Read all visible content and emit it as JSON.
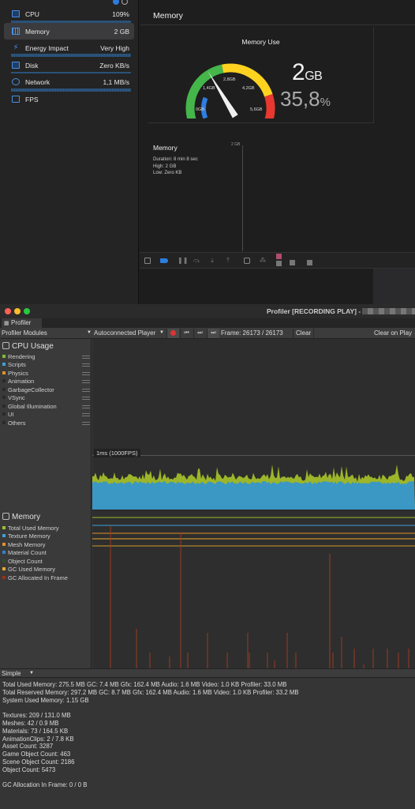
{
  "xcode": {
    "gauges": [
      {
        "name": "CPU",
        "value": "109%",
        "icon": "cpu-icon"
      },
      {
        "name": "Memory",
        "value": "2 GB",
        "icon": "memory-icon",
        "selected": true
      },
      {
        "name": "Energy Impact",
        "value": "Very High",
        "icon": "energy-icon"
      },
      {
        "name": "Disk",
        "value": "Zero KB/s",
        "icon": "disk-icon"
      },
      {
        "name": "Network",
        "value": "1,1 MB/s",
        "icon": "network-icon"
      },
      {
        "name": "FPS",
        "value": "",
        "icon": "fps-icon"
      }
    ],
    "title": "Memory",
    "memory_use": {
      "heading": "Memory Use",
      "value": "2",
      "unit": "GB",
      "percent": "35,8",
      "percent_sign": "%",
      "gauge_fraction": 0.36,
      "ticks": [
        "0GB",
        "1,4GB",
        "2,8GB",
        "4,2GB",
        "5,6GB"
      ],
      "colors": {
        "blue": "#2f7de1",
        "green": "#45b649",
        "yellow": "#ffd21f",
        "red": "#e8382f"
      }
    },
    "memory_graph": {
      "heading": "Memory",
      "duration": "Duration: 8 min 8 sec",
      "high": "High: 2 GB",
      "low": "Low: Zero KB",
      "axis_label": "2 GB"
    }
  },
  "unity": {
    "window_title": "Profiler [RECORDING PLAY] -",
    "window_title_suffix": "20",
    "tab_label": "Profiler",
    "toolbar": {
      "modules": "Profiler Modules",
      "target": "Autoconnected Player",
      "frame": "Frame: 26173 / 26173",
      "clear": "Clear",
      "clear_on_play": "Clear on Play"
    },
    "cpu": {
      "heading": "CPU Usage",
      "legend": [
        {
          "label": "Rendering",
          "color": "#7dbf2e"
        },
        {
          "label": "Scripts",
          "color": "#3ea0d6"
        },
        {
          "label": "Physics",
          "color": "#e0902a"
        },
        {
          "label": "Animation",
          "color": "#2a2a2a"
        },
        {
          "label": "GarbageCollector",
          "color": "#2a2a2a"
        },
        {
          "label": "VSync",
          "color": "#2a2a2a"
        },
        {
          "label": "Global Illumination",
          "color": "#2a2a2a"
        },
        {
          "label": "UI",
          "color": "#2a2a2a"
        },
        {
          "label": "Others",
          "color": "#2a2a2a"
        }
      ],
      "scale_label": "1ms (1000FPS)"
    },
    "memory": {
      "heading": "Memory",
      "legend": [
        {
          "label": "Total Used Memory",
          "color": "#9bbf2e"
        },
        {
          "label": "Texture Memory",
          "color": "#3ea0d6"
        },
        {
          "label": "Mesh Memory",
          "color": "#e0902a"
        },
        {
          "label": "Material Count",
          "color": "#3b7fc4"
        },
        {
          "label": "Object Count",
          "color": "#2f4f2f"
        },
        {
          "label": "GC Used Memory",
          "color": "#e8a92a"
        },
        {
          "label": "GC Allocated In Frame",
          "color": "#9c2e1e"
        }
      ]
    },
    "view_mode": "Simple",
    "stats": [
      "Total Used Memory: 275.5 MB   GC: 7.4 MB   Gfx: 162.4 MB   Audio: 1.6 MB   Video: 1.0 KB   Profiler: 33.0 MB",
      "Total Reserved Memory: 297.2 MB   GC: 8.7 MB   Gfx: 162.4 MB   Audio: 1.6 MB   Video: 1.0 KB   Profiler: 33.2 MB",
      "System Used Memory: 1.15 GB",
      "",
      "Textures: 209 / 131.0 MB",
      "Meshes: 42 / 0.9 MB",
      "Materials: 73 / 164.5 KB",
      "AnimationClips: 2 / 7.8 KB",
      "Asset Count: 3287",
      "Game Object Count: 463",
      "Scene Object Count: 2186",
      "Object Count: 5473",
      "",
      "GC Allocation In Frame: 0 / 0 B"
    ]
  }
}
